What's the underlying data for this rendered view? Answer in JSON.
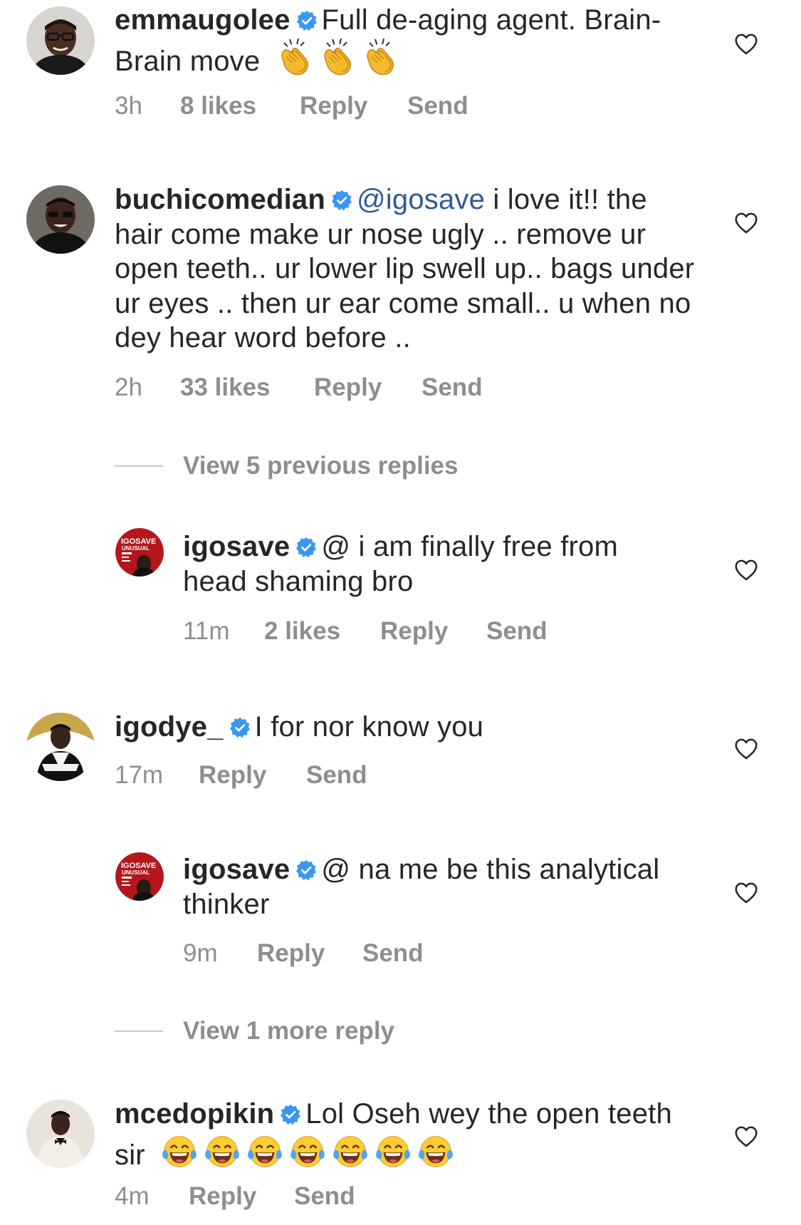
{
  "comments": [
    {
      "username": "emmaugolee",
      "text": "Full de-aging agent. Brain-Brain move",
      "emoji": [
        "clapping-hands",
        "clapping-hands",
        "clapping-hands"
      ],
      "time": "3h",
      "likes": "8 likes",
      "reply_label": "Reply",
      "send_label": "Send"
    },
    {
      "username": "buchicomedian",
      "mention": "@igosave",
      "text": "i love it!! the hair come make ur nose ugly .. remove ur open teeth.. ur lower lip swell up.. bags under ur eyes .. then ur ear come small.. u when no dey hear word before ..",
      "time": "2h",
      "likes": "33 likes",
      "reply_label": "Reply",
      "send_label": "Send",
      "view_replies": "View 5 previous replies",
      "replies": [
        {
          "username": "igosave",
          "text": "@ i am finally free from head shaming bro",
          "time": "11m",
          "likes": "2 likes",
          "reply_label": "Reply",
          "send_label": "Send"
        }
      ]
    },
    {
      "username": "igodye_",
      "text": "I for nor know you",
      "time": "17m",
      "reply_label": "Reply",
      "send_label": "Send",
      "replies": [
        {
          "username": "igosave",
          "text": "@ na me be this analytical thinker",
          "time": "9m",
          "reply_label": "Reply",
          "send_label": "Send"
        }
      ],
      "view_replies": "View 1 more reply"
    },
    {
      "username": "mcedopikin",
      "text": "Lol Oseh wey the open teeth sir",
      "emoji": [
        "tears-of-joy",
        "tears-of-joy",
        "tears-of-joy",
        "tears-of-joy",
        "tears-of-joy",
        "tears-of-joy",
        "tears-of-joy"
      ],
      "time": "4m",
      "reply_label": "Reply",
      "send_label": "Send"
    }
  ],
  "avatar_logo_text": [
    "IGOSAVE",
    "UNUSUAL"
  ],
  "colors": {
    "verified_badge": "#3897f0",
    "mention": "#2f5a94",
    "meta_text": "#8e8e8e",
    "username": "#262626",
    "divider_line": "#c7c7c7",
    "logo_red": "#b3161b"
  }
}
